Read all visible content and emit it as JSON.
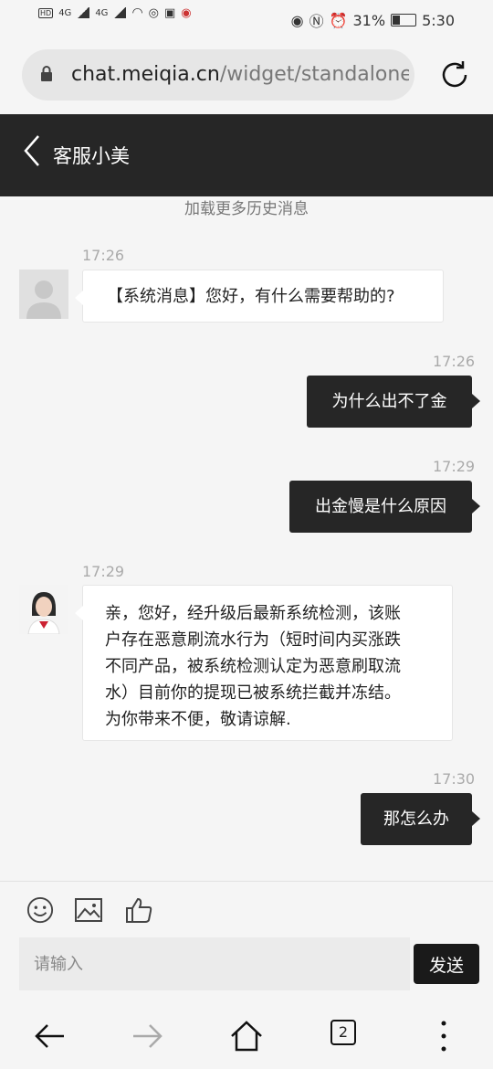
{
  "status_bar": {
    "signal_1": "4G",
    "signal_2": "4G",
    "battery": "31%",
    "time": "5:30"
  },
  "browser": {
    "url_host": "chat.meiqia.cn",
    "url_path": "/widget/standalone"
  },
  "header": {
    "title": "客服小美"
  },
  "chat": {
    "load_more": "加载更多历史消息",
    "messages": [
      {
        "from": "agent",
        "time": "17:26",
        "text": "【系统消息】您好，有什么需要帮助的?"
      },
      {
        "from": "user",
        "time": "17:26",
        "text": "为什么出不了金"
      },
      {
        "from": "user",
        "time": "17:29",
        "text": "出金慢是什么原因"
      },
      {
        "from": "agent",
        "time": "17:29",
        "lines": [
          "亲，您好，经升级后最新系统检测，该账",
          "户存在恶意刷流水行为（短时间内买涨跌",
          "不同产品，被系统检测认定为恶意刷取流",
          "水）目前你的提现已被系统拦截并冻结。",
          "为你带来不便，敬请谅解."
        ]
      },
      {
        "from": "user",
        "time": "17:30",
        "text": "那怎么办"
      }
    ]
  },
  "composer": {
    "placeholder": "请输入",
    "send_label": "发送",
    "icons": [
      "emoji-icon",
      "image-icon",
      "thumbs-up-icon"
    ]
  },
  "nav": {
    "tab_count": "2"
  }
}
